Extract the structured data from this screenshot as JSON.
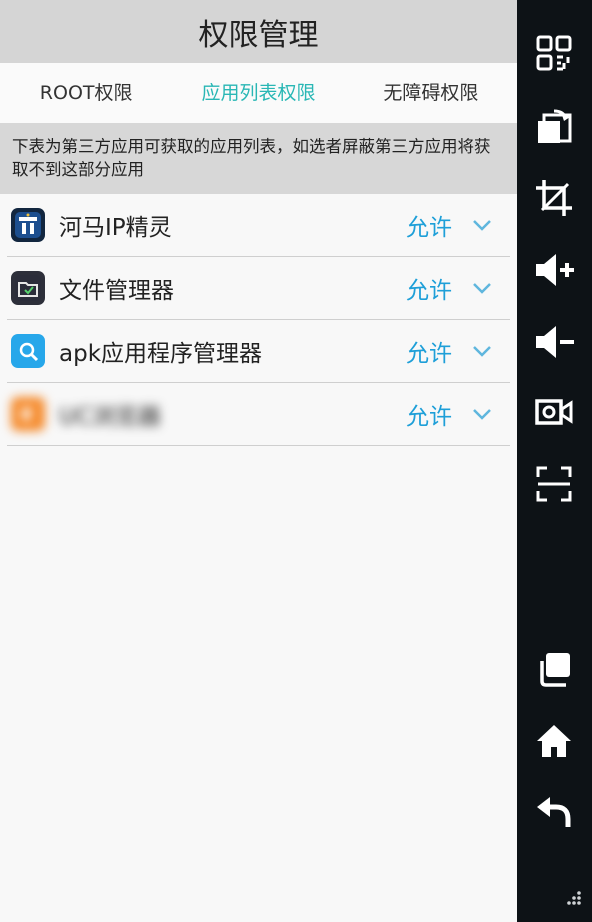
{
  "header": {
    "title": "权限管理"
  },
  "tabs": [
    {
      "label": "ROOT权限",
      "active": false
    },
    {
      "label": "应用列表权限",
      "active": true
    },
    {
      "label": "无障碍权限",
      "active": false
    }
  ],
  "notice": "下表为第三方应用可获取的应用列表，如选者屏蔽第三方应用将获取不到这部分应用",
  "apps": [
    {
      "name": "河马IP精灵",
      "permission": "允许",
      "icon": "hema-ip-app-icon"
    },
    {
      "name": "文件管理器",
      "permission": "允许",
      "icon": "file-manager-app-icon"
    },
    {
      "name": "apk应用程序管理器",
      "permission": "允许",
      "icon": "apk-manager-app-icon"
    },
    {
      "name": "UC浏览器",
      "permission": "允许",
      "icon": "uc-browser-app-icon"
    }
  ],
  "colors": {
    "accent_tab": "#29b7b5",
    "permission_blue": "#1e9fd8",
    "header_bg": "#d5d5d5",
    "sidebar_bg": "#0d1216"
  },
  "sidebar": {
    "icons": [
      "qr-code-icon",
      "screen-rotate-icon",
      "crop-icon",
      "volume-up-icon",
      "volume-down-icon",
      "video-record-icon",
      "scan-frame-icon",
      "recent-apps-icon",
      "home-icon",
      "back-icon",
      "resize-grip-icon"
    ]
  }
}
